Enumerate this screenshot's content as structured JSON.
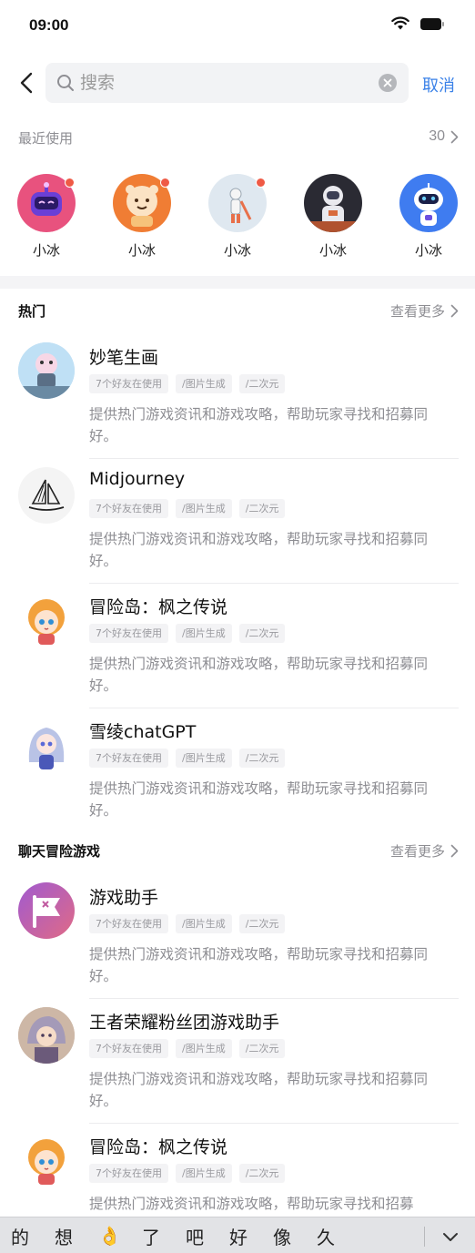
{
  "status_bar": {
    "time": "09:00"
  },
  "search": {
    "placeholder": "搜索",
    "cancel_label": "取消"
  },
  "recent": {
    "title": "最近使用",
    "count": "30",
    "items": [
      {
        "name": "小冰",
        "icon": "purple-robot-avatar",
        "badge": true
      },
      {
        "name": "小冰",
        "icon": "orange-bear-avatar",
        "badge": true
      },
      {
        "name": "小冰",
        "icon": "astronaut-guitar-avatar",
        "badge": true
      },
      {
        "name": "小冰",
        "icon": "astronaut-dark-avatar",
        "badge": false
      },
      {
        "name": "小冰",
        "icon": "white-robot-avatar",
        "badge": false
      }
    ]
  },
  "sections": [
    {
      "title": "热门",
      "more_label": "查看更多",
      "items": [
        {
          "name": "妙笔生画",
          "icon": "painting-robot-avatar",
          "tags": [
            "7个好友在使用",
            "/图片生成",
            "/二次元"
          ],
          "description": "提供热门游戏资讯和游戏攻略，帮助玩家寻找和招募同好。"
        },
        {
          "name": "Midjourney",
          "icon": "sailboat-logo",
          "tags": [
            "7个好友在使用",
            "/图片生成",
            "/二次元"
          ],
          "description": "提供热门游戏资讯和游戏攻略，帮助玩家寻找和招募同好。"
        },
        {
          "name": "冒险岛：枫之传说",
          "icon": "anime-girl-orange-avatar",
          "tags": [
            "7个好友在使用",
            "/图片生成",
            "/二次元"
          ],
          "description": "提供热门游戏资讯和游戏攻略，帮助玩家寻找和招募同好。"
        },
        {
          "name": "雪绫chatGPT",
          "icon": "anime-girl-silver-avatar",
          "tags": [
            "7个好友在使用",
            "/图片生成",
            "/二次元"
          ],
          "description": "提供热门游戏资讯和游戏攻略，帮助玩家寻找和招募同好。"
        }
      ]
    },
    {
      "title": "聊天冒险游戏",
      "more_label": "查看更多",
      "items": [
        {
          "name": "游戏助手",
          "icon": "flag-logo",
          "tags": [
            "7个好友在使用",
            "/图片生成",
            "/二次元"
          ],
          "description": "提供热门游戏资讯和游戏攻略，帮助玩家寻找和招募同好。"
        },
        {
          "name": "王者荣耀粉丝团游戏助手",
          "icon": "game-hero-avatar",
          "tags": [
            "7个好友在使用",
            "/图片生成",
            "/二次元"
          ],
          "description": "提供热门游戏资讯和游戏攻略，帮助玩家寻找和招募同好。"
        },
        {
          "name": "冒险岛：枫之传说",
          "icon": "anime-girl-orange-avatar",
          "tags": [
            "7个好友在使用",
            "/图片生成",
            "/二次元"
          ],
          "description": "提供热门游戏资讯和游戏攻略，帮助玩家寻找和招募"
        }
      ]
    }
  ],
  "keyboard": {
    "suggestions": [
      "的",
      "想",
      "👌",
      "了",
      "吧",
      "好",
      "像",
      "久"
    ]
  },
  "colors": {
    "accent": "#3b82e8",
    "badge": "#ef5a45",
    "muted": "#8e8e93"
  }
}
